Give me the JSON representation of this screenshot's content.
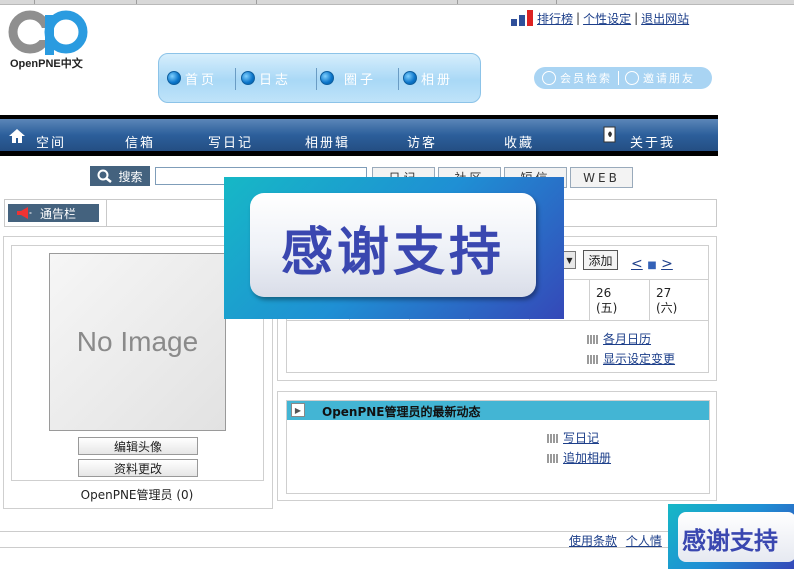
{
  "brand": {
    "logo_text": "OpenPNE中文"
  },
  "top_links": [
    {
      "label": "排行榜"
    },
    {
      "label": "个性设定"
    },
    {
      "label": "退出网站"
    }
  ],
  "main_nav": [
    {
      "label": "首页"
    },
    {
      "label": "日志"
    },
    {
      "label": "圈子"
    },
    {
      "label": "相册"
    }
  ],
  "member_actions": {
    "search": "会员检索",
    "invite": "邀请朋友"
  },
  "sub_nav": [
    {
      "label": "空间",
      "icon": "home-icon"
    },
    {
      "label": "信箱"
    },
    {
      "label": "写日记"
    },
    {
      "label": "相册辑"
    },
    {
      "label": "访客"
    },
    {
      "label": "收藏"
    },
    {
      "label": "关于我",
      "icon": "book-icon"
    }
  ],
  "search": {
    "button_label": "搜索",
    "input_value": "",
    "tabs": [
      {
        "label": "日记"
      },
      {
        "label": "社区"
      },
      {
        "label": "短信"
      },
      {
        "label": "WEB"
      }
    ]
  },
  "notice": {
    "label": "通告栏"
  },
  "profile": {
    "image_placeholder": "No Image",
    "edit_avatar": "编辑头像",
    "edit_profile": "资料更改",
    "name": "OpenPNE管理员",
    "count": "(0)"
  },
  "calendar": {
    "add_button": "添加",
    "nav_prev": "<",
    "nav_today": "■",
    "nav_next": ">",
    "days": [
      {
        "date": "26",
        "weekday": "(五)"
      },
      {
        "date": "27",
        "weekday": "(六)"
      }
    ],
    "links": [
      {
        "label": "各月日历"
      },
      {
        "label": "显示设定变更"
      }
    ]
  },
  "news": {
    "title": "OpenPNE管理员的最新动态",
    "links": [
      {
        "label": "写日记"
      },
      {
        "label": "追加相册"
      }
    ]
  },
  "footer": {
    "links": [
      {
        "label": "使用条款"
      },
      {
        "label": "个人情"
      }
    ]
  },
  "overlay": {
    "text": "感谢支持"
  },
  "colors": {
    "nav_bar": "#2c5f9b",
    "news_header": "#43b5d4",
    "link": "#1d3f8a"
  }
}
